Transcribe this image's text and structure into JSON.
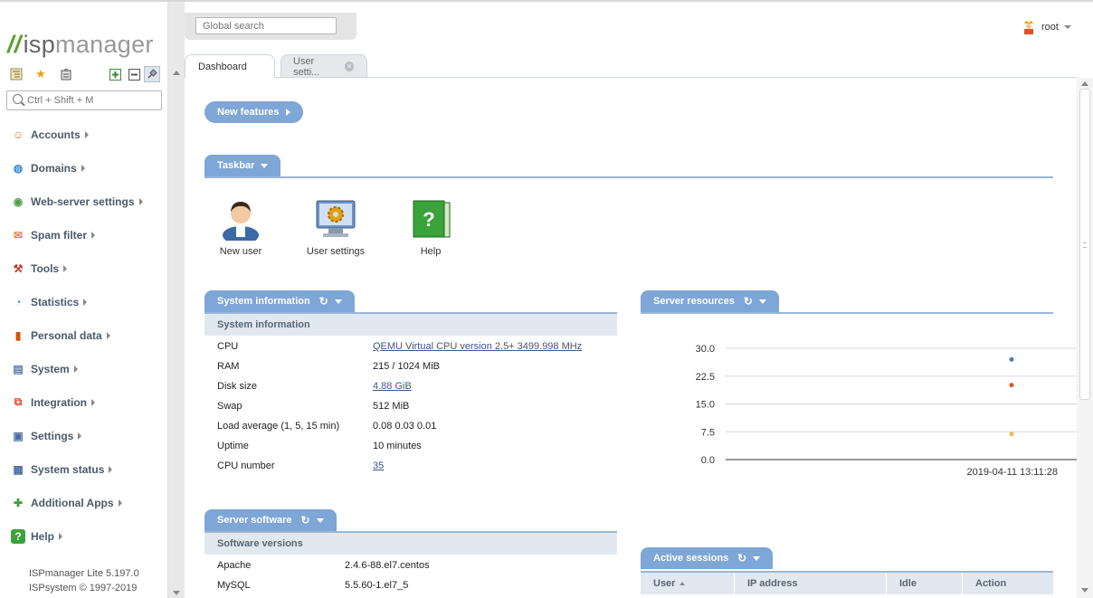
{
  "app": {
    "logo_text": "ispmanager",
    "version": "ISPmanager Lite 5.197.0",
    "copyright": "ISPsystem © 1997-2019"
  },
  "sidebar": {
    "search_placeholder": "Ctrl + Shift + M",
    "tool_icons": [
      "tree-icon",
      "star-icon",
      "clipboard-icon",
      "expand-all-icon",
      "collapse-all-icon",
      "pin-icon"
    ],
    "items": [
      {
        "label": "Accounts",
        "icon": "accounts-icon",
        "color": "#c9822a"
      },
      {
        "label": "Domains",
        "icon": "globe-icon",
        "color": "#3b8fd0"
      },
      {
        "label": "Web-server settings",
        "icon": "web-server-icon",
        "color": "#4aa04a"
      },
      {
        "label": "Spam filter",
        "icon": "spam-filter-icon",
        "color": "#e38a2a"
      },
      {
        "label": "Tools",
        "icon": "tools-icon",
        "color": "#c0392b"
      },
      {
        "label": "Statistics",
        "icon": "statistics-pie-icon",
        "color": "#3b8fd0"
      },
      {
        "label": "Personal data",
        "icon": "bar-chart-icon",
        "color": "#d35400"
      },
      {
        "label": "System",
        "icon": "system-icon",
        "color": "#5577aa"
      },
      {
        "label": "Integration",
        "icon": "integration-icon",
        "color": "#d9532c"
      },
      {
        "label": "Settings",
        "icon": "settings-monitor-icon",
        "color": "#4a6fa0"
      },
      {
        "label": "System status",
        "icon": "system-status-icon",
        "color": "#4a6fa0"
      },
      {
        "label": "Additional Apps",
        "icon": "plus-icon",
        "color": "#3aa33a"
      },
      {
        "label": "Help",
        "icon": "help-icon",
        "color": "#3aa33a"
      }
    ]
  },
  "header": {
    "global_search_placeholder": "Global search",
    "user": "root"
  },
  "tabs": [
    {
      "label": "Dashboard",
      "active": true
    },
    {
      "label": "User setti...",
      "active": false
    }
  ],
  "dashboard": {
    "new_features_label": "New features",
    "taskbar_label": "Taskbar",
    "taskbar_items": [
      {
        "label": "New user",
        "icon": "new-user-icon"
      },
      {
        "label": "User settings",
        "icon": "user-settings-icon"
      },
      {
        "label": "Help",
        "icon": "help-book-icon"
      }
    ],
    "system_information": {
      "title": "System information",
      "subtitle": "System information",
      "rows": [
        {
          "key": "CPU",
          "value": "QEMU Virtual CPU version 2.5+ 3499.998 MHz",
          "link": true
        },
        {
          "key": "RAM",
          "value": "215 / 1024 MiB",
          "link": false
        },
        {
          "key": "Disk size",
          "value": "4.88 GiB",
          "link": true
        },
        {
          "key": "Swap",
          "value": "512 MiB",
          "link": false
        },
        {
          "key": "Load average (1, 5, 15 min)",
          "value": "0.08 0.03 0.01",
          "link": false
        },
        {
          "key": "Uptime",
          "value": "10 minutes",
          "link": false
        },
        {
          "key": "CPU number",
          "value": "35",
          "link": true
        }
      ]
    },
    "server_software": {
      "title": "Server software",
      "subtitle": "Software versions",
      "rows": [
        {
          "key": "Apache",
          "value": "2.4.6-88.el7.centos"
        },
        {
          "key": "MySQL",
          "value": "5.5.60-1.el7_5"
        }
      ]
    },
    "server_resources": {
      "title": "Server resources"
    },
    "active_sessions": {
      "title": "Active sessions",
      "columns": [
        "User",
        "IP address",
        "Idle",
        "Action"
      ]
    }
  },
  "chart_data": {
    "type": "scatter",
    "title": "",
    "xlabel": "",
    "ylabel": "",
    "yticks": [
      "30.0",
      "22.5",
      "15.0",
      "7.5",
      "0.0"
    ],
    "ylim": [
      0,
      30
    ],
    "x_tick_label": "2019-04-11 13:11:28",
    "grid": true,
    "series": [
      {
        "values": [
          27.0
        ],
        "color": "#4a7cc0"
      },
      {
        "values": [
          20.1
        ],
        "color": "#d9532c"
      },
      {
        "values": [
          6.9
        ],
        "color": "#f0b860"
      }
    ]
  }
}
